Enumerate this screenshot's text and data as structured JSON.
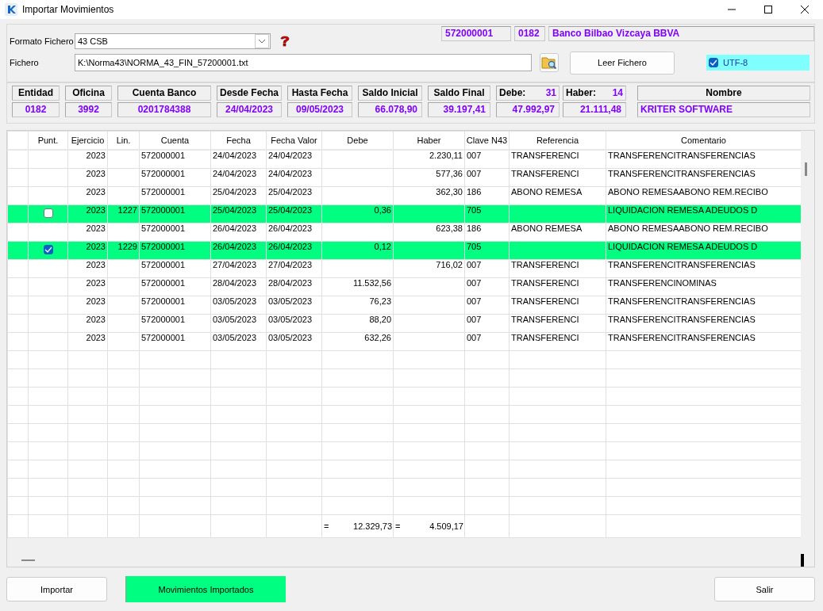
{
  "window": {
    "title": "Importar Movimientos"
  },
  "file_format": {
    "label": "Formato Fichero",
    "value": "43 CSB"
  },
  "account_fields": [
    {
      "value": "572000001"
    },
    {
      "value": "0182"
    },
    {
      "value": "Banco Bilbao Vizcaya BBVA"
    }
  ],
  "file": {
    "label": "Fichero",
    "value": "K:\\Norma43\\NORMA_43_FIN_57200001.txt"
  },
  "read_button": "Leer Fichero",
  "utf8": {
    "label": "UTF-8",
    "checked": true
  },
  "summary": [
    {
      "label": "Entidad",
      "value": "0182"
    },
    {
      "label": "Oficina",
      "value": "3992"
    },
    {
      "label": "Cuenta Banco",
      "value": "0201784388"
    },
    {
      "label": "Desde Fecha",
      "value": "24/04/2023"
    },
    {
      "label": "Hasta Fecha",
      "value": "09/05/2023"
    },
    {
      "label": "Saldo Inicial",
      "value": "66.078,90"
    },
    {
      "label": "Saldo Final",
      "value": "39.197,41"
    },
    {
      "label": "Debe:",
      "count": "31",
      "value": "47.992,97"
    },
    {
      "label": "Haber:",
      "count": "14",
      "value": "21.111,48"
    },
    {
      "label": "Nombre",
      "value": "KRITER SOFTWARE"
    }
  ],
  "table": {
    "columns": [
      "Punt.",
      "Ejercicio",
      "Lin.",
      "Cuenta",
      "Fecha",
      "Fecha Valor",
      "Debe",
      "Haber",
      "Clave N43",
      "Referencia",
      "Comentario"
    ],
    "rows": [
      {
        "kind": "plain",
        "cells": [
          "",
          "2023",
          "",
          "572000001",
          "24/04/2023",
          "24/04/2023",
          "",
          "2.230,11",
          "007",
          "TRANSFERENCI",
          "TRANSFERENCITRANSFERENCIAS"
        ]
      },
      {
        "kind": "plain",
        "cells": [
          "",
          "2023",
          "",
          "572000001",
          "24/04/2023",
          "24/04/2023",
          "",
          "577,36",
          "007",
          "TRANSFERENCI",
          "TRANSFERENCITRANSFERENCIAS"
        ]
      },
      {
        "kind": "plain",
        "cells": [
          "",
          "2023",
          "",
          "572000001",
          "25/04/2023",
          "25/04/2023",
          "",
          "362,30",
          "186",
          "ABONO REMESA",
          "ABONO REMESAABONO REM.RECIBO"
        ]
      },
      {
        "kind": "checkable",
        "checked": false,
        "cells": [
          "",
          "2023",
          "1227",
          "572000001",
          "25/04/2023",
          "25/04/2023",
          "0,36",
          "",
          "705",
          "",
          "LIQUIDACION REMESA ADEUDOS D"
        ]
      },
      {
        "kind": "plain",
        "cells": [
          "",
          "2023",
          "",
          "572000001",
          "26/04/2023",
          "26/04/2023",
          "",
          "623,38",
          "186",
          "ABONO REMESA",
          "ABONO REMESAABONO REM.RECIBO"
        ]
      },
      {
        "kind": "checkable",
        "checked": true,
        "cells": [
          "",
          "2023",
          "1229",
          "572000001",
          "26/04/2023",
          "26/04/2023",
          "0,12",
          "",
          "705",
          "",
          "LIQUIDACION REMESA ADEUDOS D"
        ]
      },
      {
        "kind": "plain",
        "cells": [
          "",
          "2023",
          "",
          "572000001",
          "27/04/2023",
          "27/04/2023",
          "",
          "716,02",
          "007",
          "TRANSFERENCI",
          "TRANSFERENCITRANSFERENCIAS"
        ]
      },
      {
        "kind": "plain",
        "cells": [
          "",
          "2023",
          "",
          "572000001",
          "28/04/2023",
          "28/04/2023",
          "11.532,56",
          "",
          "007",
          "TRANSFERENCI",
          "TRANSFERENCINOMINAS"
        ]
      },
      {
        "kind": "plain",
        "cells": [
          "",
          "2023",
          "",
          "572000001",
          "03/05/2023",
          "03/05/2023",
          "76,23",
          "",
          "007",
          "TRANSFERENCI",
          "TRANSFERENCITRANSFERENCIAS"
        ]
      },
      {
        "kind": "plain",
        "cells": [
          "",
          "2023",
          "",
          "572000001",
          "03/05/2023",
          "03/05/2023",
          "88,20",
          "",
          "007",
          "TRANSFERENCI",
          "TRANSFERENCITRANSFERENCIAS"
        ]
      },
      {
        "kind": "plain",
        "cells": [
          "",
          "2023",
          "",
          "572000001",
          "03/05/2023",
          "03/05/2023",
          "632,26",
          "",
          "007",
          "TRANSFERENCI",
          "TRANSFERENCITRANSFERENCIAS"
        ]
      }
    ],
    "totals": [
      {
        "sign": "=",
        "value": "12.329,73"
      },
      {
        "sign": "=",
        "value": "4.509,17"
      }
    ]
  },
  "buttons": {
    "import": "Importar",
    "status": "Movimientos Importados",
    "exit": "Salir"
  }
}
